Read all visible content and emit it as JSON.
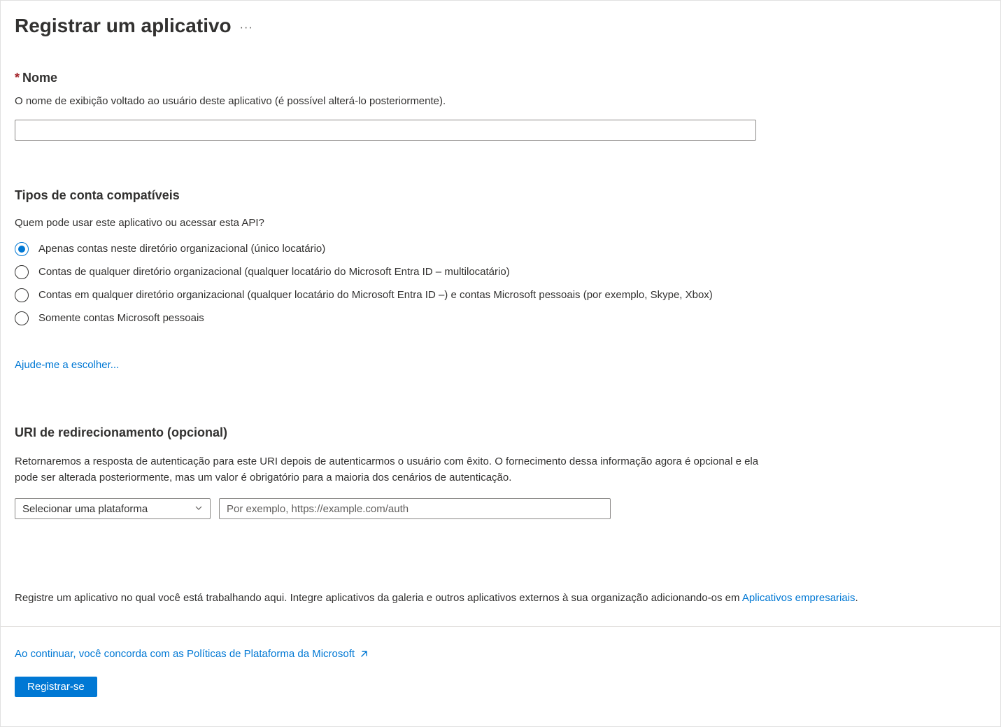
{
  "header": {
    "title": "Registrar um aplicativo"
  },
  "nameSection": {
    "label": "Nome",
    "description": "O nome de exibição voltado ao usuário deste aplicativo (é possível alterá-lo posteriormente).",
    "value": ""
  },
  "accountTypes": {
    "heading": "Tipos de conta compatíveis",
    "question": "Quem pode usar este aplicativo ou acessar esta API?",
    "options": [
      "Apenas contas neste diretório organizacional (único locatário)",
      "Contas de qualquer diretório organizacional (qualquer locatário do Microsoft Entra ID – multilocatário)",
      "Contas em qualquer diretório organizacional (qualquer locatário do Microsoft Entra ID –) e contas Microsoft pessoais (por exemplo, Skype, Xbox)",
      "Somente contas Microsoft pessoais"
    ],
    "selectedIndex": 0,
    "helpLink": "Ajude-me a escolher..."
  },
  "redirectUri": {
    "heading": "URI de redirecionamento (opcional)",
    "description": "Retornaremos a resposta de autenticação para este URI depois de autenticarmos o usuário com êxito. O fornecimento dessa informação agora é opcional e ela pode ser alterada posteriormente, mas um valor é obrigatório para a maioria dos cenários de autenticação.",
    "platformPlaceholder": "Selecionar uma plataforma",
    "uriPlaceholder": "Por exemplo, https://example.com/auth"
  },
  "footer": {
    "notePrefix": "Registre um aplicativo no qual você está trabalhando aqui. Integre aplicativos da galeria e outros aplicativos externos à sua organização adicionando-os em ",
    "noteLink": "Aplicativos empresariais",
    "noteSuffix": ".",
    "policyText": "Ao continuar, você concorda com as Políticas de Plataforma da Microsoft",
    "registerButton": "Registrar-se"
  }
}
